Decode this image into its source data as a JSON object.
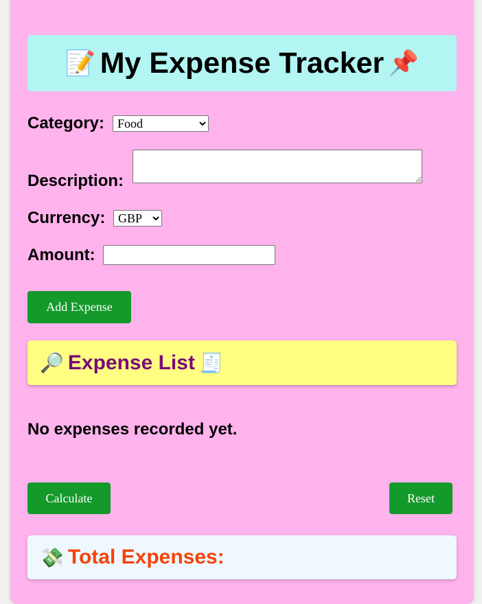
{
  "header": {
    "icon_left": "📝",
    "title": "My Expense Tracker",
    "icon_right": "📌"
  },
  "form": {
    "category_label": "Category:",
    "category_value": "Food",
    "description_label": "Description:",
    "description_value": "",
    "currency_label": "Currency:",
    "currency_value": "GBP",
    "amount_label": "Amount:",
    "amount_value": "",
    "add_button": "Add Expense"
  },
  "expense_list": {
    "icon_left": "🔎",
    "title": "Expense List",
    "icon_right": "🧾",
    "empty_message": "No expenses recorded yet."
  },
  "actions": {
    "calculate": "Calculate",
    "reset": "Reset"
  },
  "total": {
    "icon": "💸",
    "label": "Total Expenses:"
  },
  "colors": {
    "background": "#ffb3ec",
    "title_box": "#b2f5f2",
    "list_box": "#fffd82",
    "total_box": "#f0f8ff",
    "button": "#14992b",
    "list_title": "#7a0a78",
    "total_title": "#f5420a"
  }
}
